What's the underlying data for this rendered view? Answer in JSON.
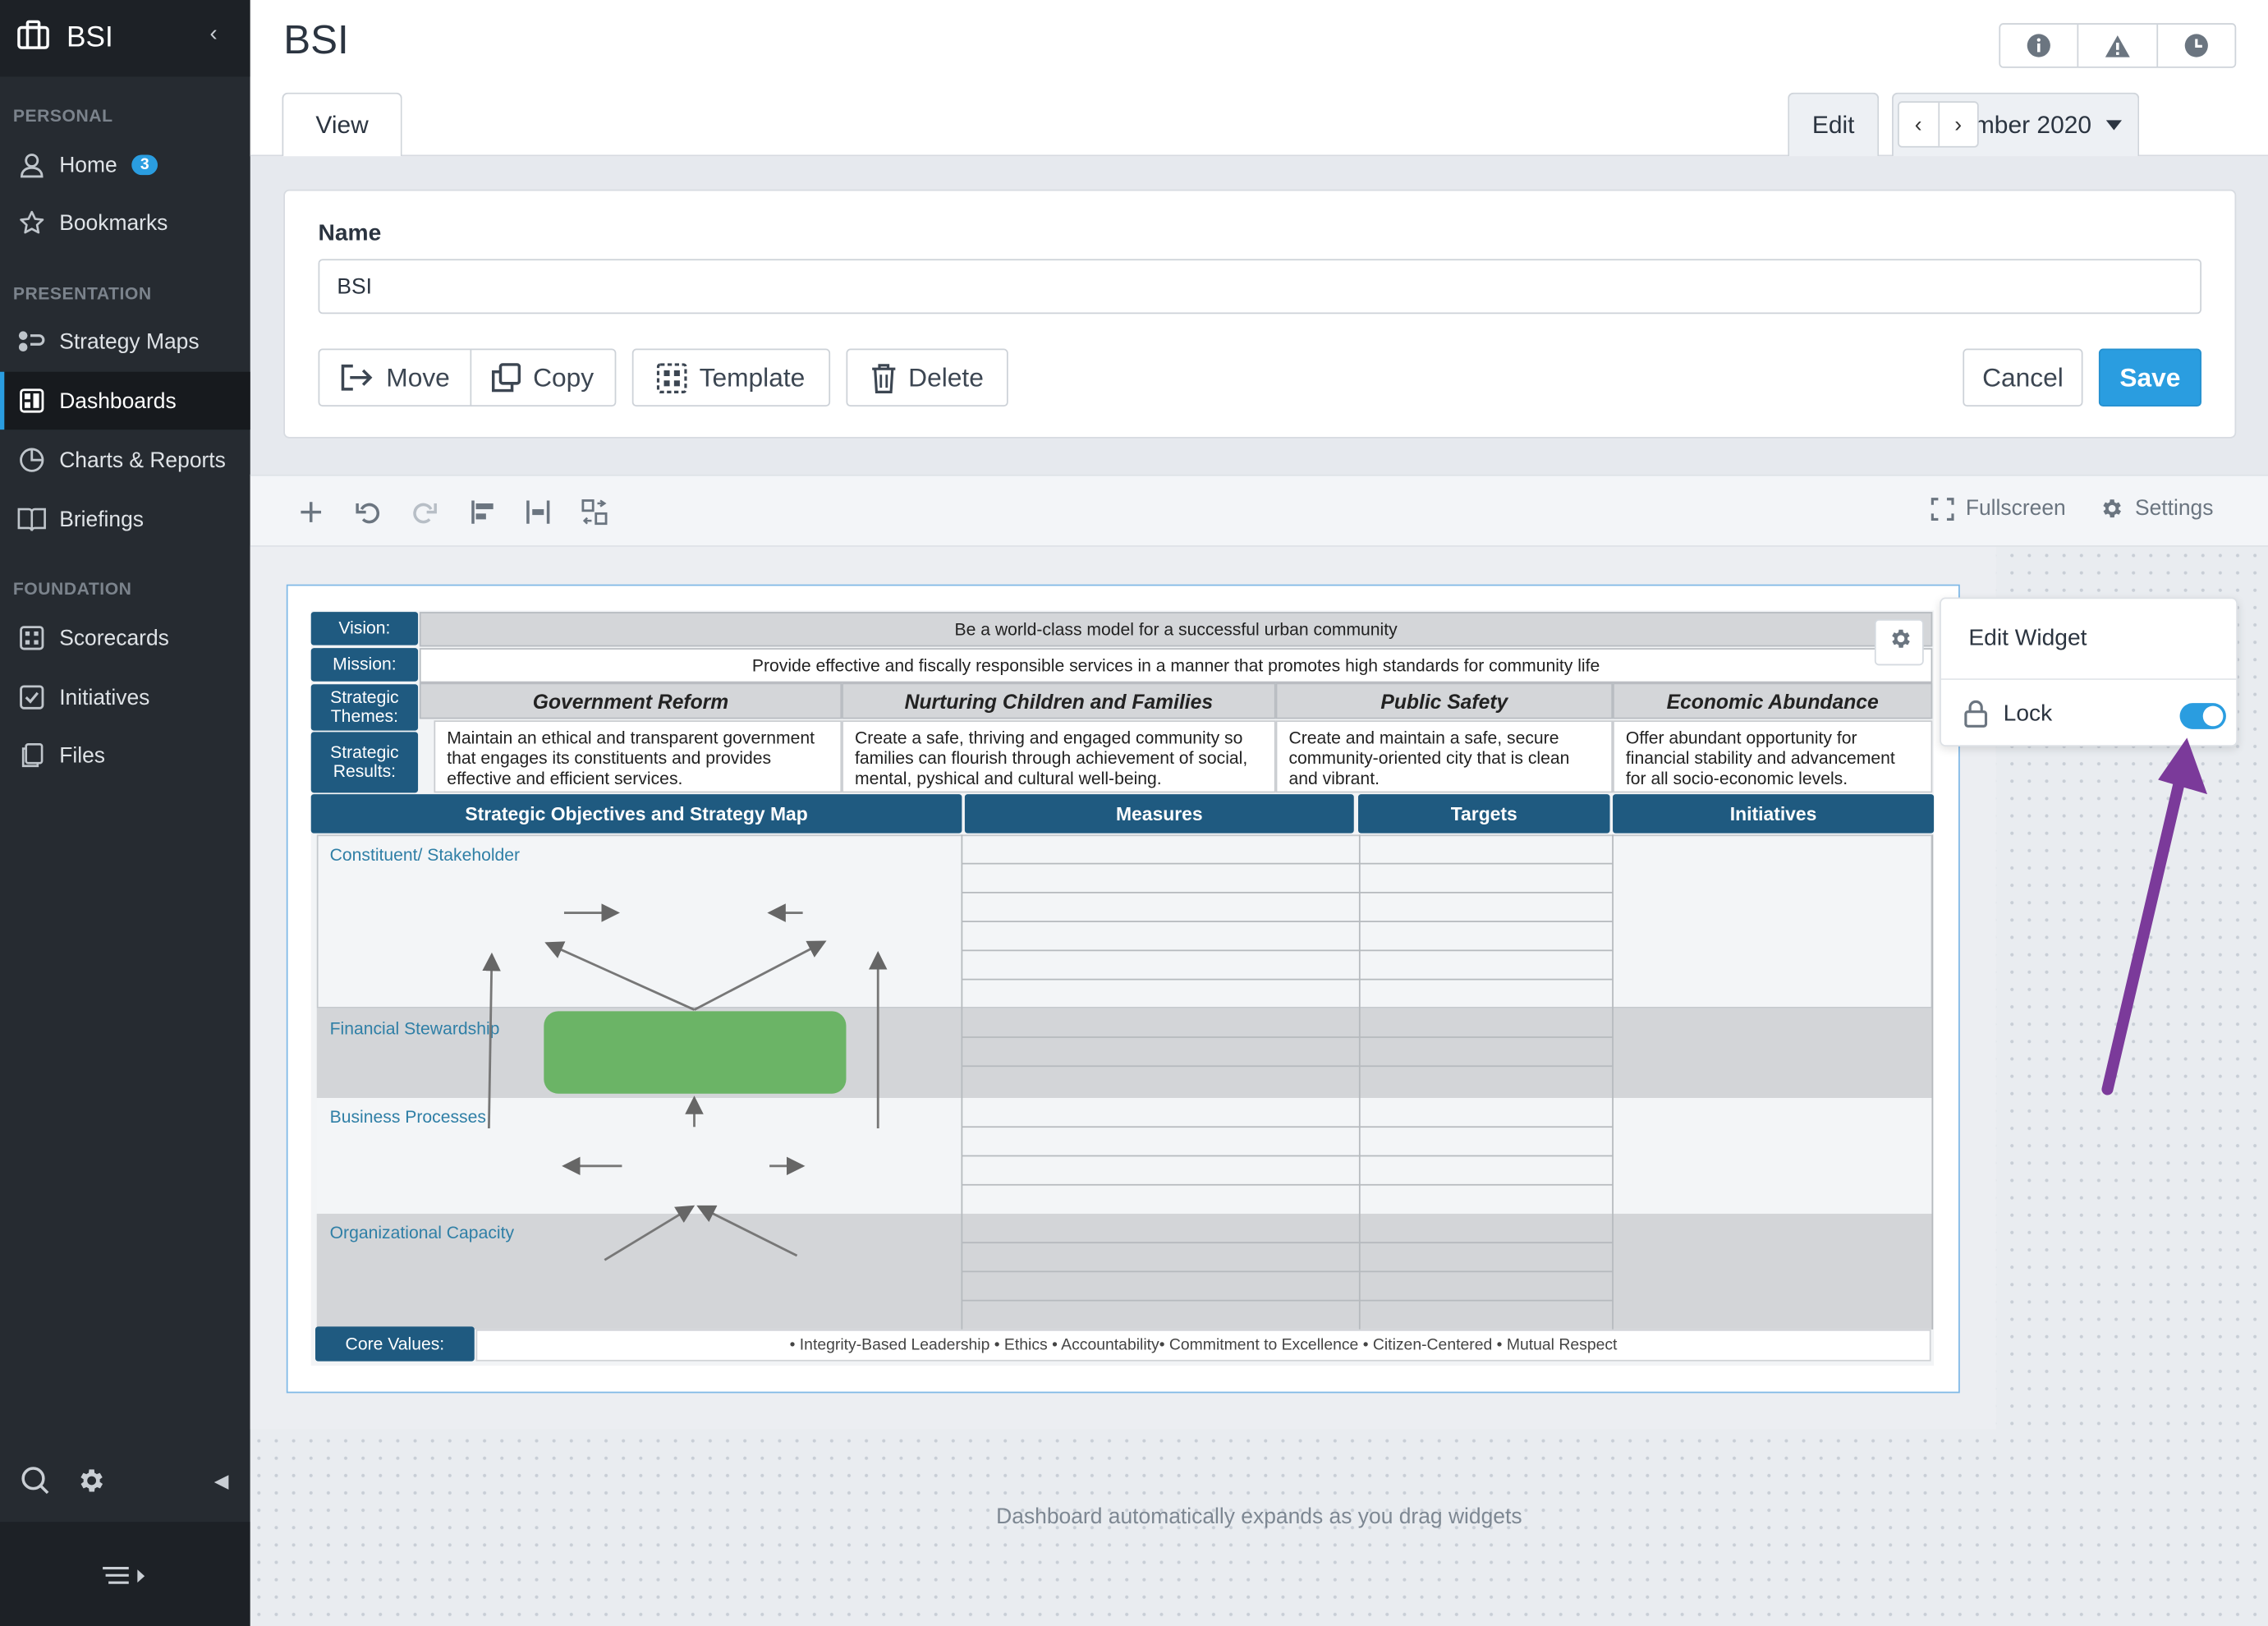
{
  "sidebar": {
    "app_name": "BSI",
    "sections": {
      "personal": "PERSONAL",
      "presentation": "PRESENTATION",
      "foundation": "FOUNDATION"
    },
    "items": [
      {
        "label": "Home",
        "icon": "user-icon",
        "badge": "3"
      },
      {
        "label": "Bookmarks",
        "icon": "star-icon"
      },
      {
        "label": "Strategy Maps",
        "icon": "strategy-map-icon"
      },
      {
        "label": "Dashboards",
        "icon": "dashboard-icon",
        "active": true
      },
      {
        "label": "Charts & Reports",
        "icon": "pie-chart-icon"
      },
      {
        "label": "Briefings",
        "icon": "book-icon"
      },
      {
        "label": "Scorecards",
        "icon": "scorecard-icon"
      },
      {
        "label": "Initiatives",
        "icon": "checkbox-icon"
      },
      {
        "label": "Files",
        "icon": "files-icon"
      }
    ]
  },
  "header": {
    "title": "BSI",
    "tabs": {
      "view": "View",
      "edit": "Edit"
    },
    "period": "November 2020"
  },
  "form": {
    "name_label": "Name",
    "name_value": "BSI",
    "buttons": {
      "move": "Move",
      "copy": "Copy",
      "template": "Template",
      "delete": "Delete",
      "cancel": "Cancel",
      "save": "Save"
    }
  },
  "toolbar": {
    "fullscreen": "Fullscreen",
    "settings": "Settings"
  },
  "popover": {
    "title": "Edit Widget",
    "lock_label": "Lock",
    "lock_on": true
  },
  "bsi": {
    "labels": {
      "vision": "Vision:",
      "mission": "Mission:",
      "themes": "Strategic Themes:",
      "results": "Strategic Results:",
      "core_values": "Core Values:"
    },
    "vision": "Be a world-class model for a successful urban community",
    "mission": "Provide effective and fiscally responsible services in a manner that promotes high standards for community life",
    "themes": [
      {
        "title": "Government Reform",
        "result": "Maintain an ethical and transparent government that engages its constituents and provides effective and efficient services."
      },
      {
        "title": "Nurturing Children and Families",
        "result": "Create a safe, thriving and engaged community so families can flourish through achievement of social, mental, pyshical and cultural well-being."
      },
      {
        "title": "Public Safety",
        "result": "Create and maintain a safe, secure community-oriented city that is clean and vibrant."
      },
      {
        "title": "Economic Abundance",
        "result": "Offer abundant opportunity for financial stability and advancement for all socio-economic levels."
      }
    ],
    "columns": {
      "objectives": "Strategic Objectives and Strategy Map",
      "measures": "Measures",
      "targets": "Targets",
      "initiatives": "Initiatives"
    },
    "perspectives": [
      "Constituent/ Stakeholder",
      "Financial Stewardship",
      "Business Processes",
      "Organizational Capacity"
    ],
    "core_values": "• Integrity-Based Leadership • Ethics • Accountability• Commitment to Excellence • Citizen-Centered • Mutual Respect"
  },
  "canvas_hint": "Dashboard automatically expands as you drag widgets",
  "colors": {
    "accent": "#2a9de0",
    "sidebar_bg": "#262b31",
    "bsi_blue": "#1f5a80",
    "objective_green": "#6bb466",
    "annotation_arrow": "#7b3a9a"
  }
}
